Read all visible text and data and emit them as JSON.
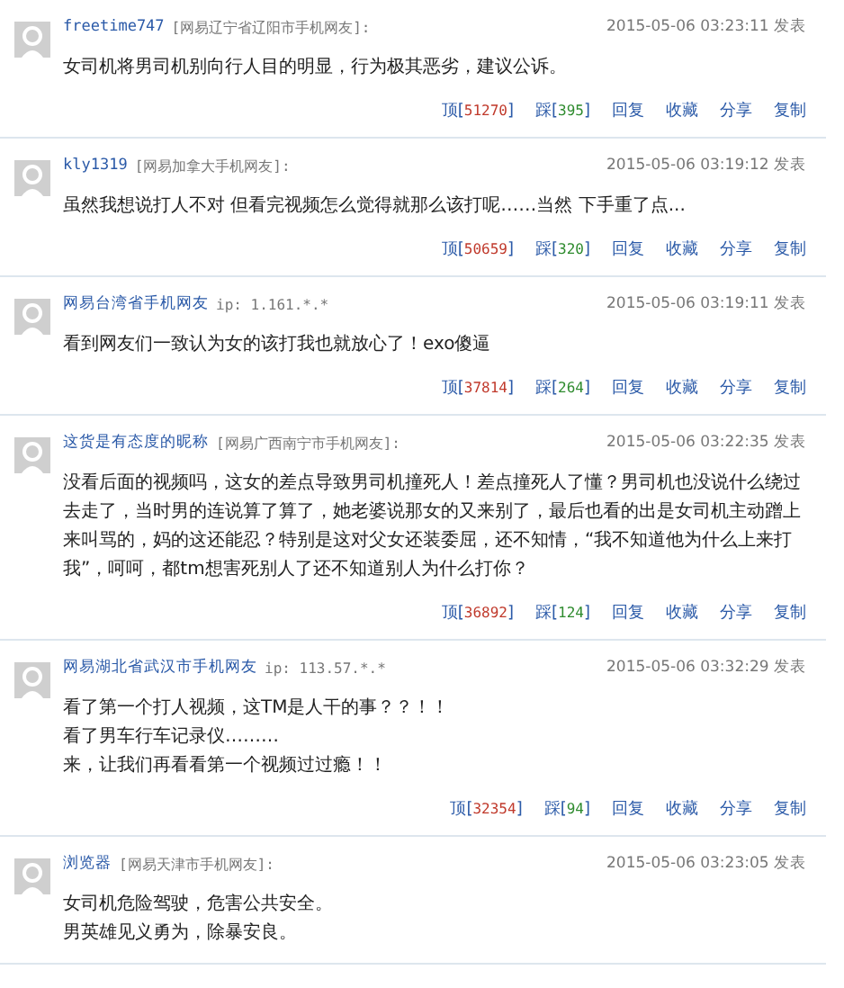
{
  "comments": [
    {
      "name": "freetime747",
      "origin": "[网易辽宁省辽阳市手机网友]:",
      "time": "2015-05-06 03:23:11 发表",
      "lines": [
        "女司机将男司机别向行人目的明显，行为极其恶劣，建议公诉。"
      ],
      "actions": {
        "up_label": "顶[",
        "up_count": "51270",
        "down_label": "踩[",
        "down_count": "395",
        "close": "]",
        "links": [
          "回复",
          "收藏",
          "分享",
          "复制"
        ]
      }
    },
    {
      "name": "kly1319",
      "origin": "[网易加拿大手机网友]:",
      "time": "2015-05-06 03:19:12 发表",
      "lines": [
        "虽然我想说打人不对 但看完视频怎么觉得就那么该打呢……当然 下手重了点..."
      ],
      "actions": {
        "up_label": "顶[",
        "up_count": "50659",
        "down_label": "踩[",
        "down_count": "320",
        "close": "]",
        "links": [
          "回复",
          "收藏",
          "分享",
          "复制"
        ]
      }
    },
    {
      "name": "网易台湾省手机网友",
      "origin": "ip: 1.161.*.*",
      "time": "2015-05-06 03:19:11 发表",
      "lines": [
        "看到网友们一致认为女的该打我也就放心了！exo傻逼"
      ],
      "actions": {
        "up_label": "顶[",
        "up_count": "37814",
        "down_label": "踩[",
        "down_count": "264",
        "close": "]",
        "links": [
          "回复",
          "收藏",
          "分享",
          "复制"
        ]
      }
    },
    {
      "name": "这货是有态度的昵称",
      "origin": "[网易广西南宁市手机网友]:",
      "time": "2015-05-06 03:22:35 发表",
      "lines": [
        "没看后面的视频吗，这女的差点导致男司机撞死人！差点撞死人了懂？男司机也没说什么绕过去走了，当时男的连说算了算了，她老婆说那女的又来别了，最后也看的出是女司机主动蹭上来叫骂的，妈的这还能忍？特别是这对父女还装委屈，还不知情，“我不知道他为什么上来打我”，呵呵，都tm想害死别人了还不知道别人为什么打你？"
      ],
      "actions": {
        "up_label": "顶[",
        "up_count": "36892",
        "down_label": "踩[",
        "down_count": "124",
        "close": "]",
        "links": [
          "回复",
          "收藏",
          "分享",
          "复制"
        ]
      }
    },
    {
      "name": "网易湖北省武汉市手机网友",
      "origin": "ip: 113.57.*.*",
      "time": "2015-05-06 03:32:29 发表",
      "lines": [
        "看了第一个打人视频，这TM是人干的事？？！！",
        "看了男车行车记录仪………",
        "来，让我们再看看第一个视频过过瘾！！"
      ],
      "actions": {
        "up_label": "顶[",
        "up_count": "32354",
        "down_label": "踩[",
        "down_count": "94",
        "close": "]",
        "links": [
          "回复",
          "收藏",
          "分享",
          "复制"
        ]
      }
    },
    {
      "name": "浏览器",
      "origin": "[网易天津市手机网友]:",
      "time": "2015-05-06 03:23:05 发表",
      "lines": [
        "女司机危险驾驶，危害公共安全。",
        "男英雄见义勇为，除暴安良。"
      ]
    }
  ]
}
